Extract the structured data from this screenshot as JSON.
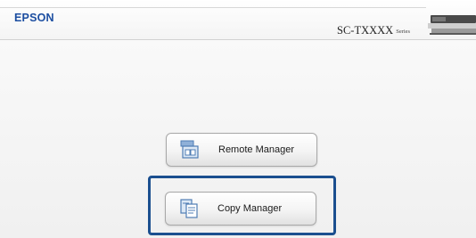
{
  "header": {
    "brand": "EPSON",
    "model": "SC-TXXXX",
    "series": "Series"
  },
  "menu": {
    "items": [
      {
        "label": "Remote Manager",
        "icon": "remote-manager-icon"
      },
      {
        "label": "Copy Manager",
        "icon": "copy-manager-icon"
      }
    ],
    "highlighted": "Copy Manager"
  },
  "colors": {
    "brand": "#1c4ea1",
    "highlight_border": "#1b4f8f"
  }
}
